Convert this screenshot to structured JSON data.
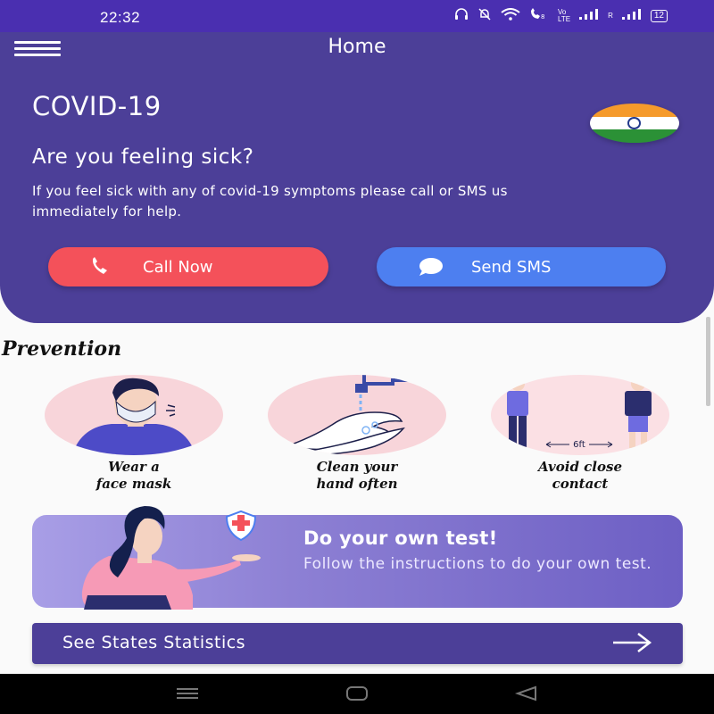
{
  "status_bar": {
    "time": "22:32",
    "indicators": [
      "headphones-icon",
      "mute-icon",
      "wifi-icon",
      "vowifi-icon",
      "volte-icon",
      "signal-icon",
      "signal-r-icon"
    ],
    "vo_label": "Vo\nLTE",
    "r_label": "R",
    "battery": "12"
  },
  "header": {
    "title": "Home",
    "menu_icon": "hamburger-icon"
  },
  "hero": {
    "title": "COVID-19",
    "question": "Are you feeling sick?",
    "description": "If you feel sick with any of covid-19 symptoms please call or SMS us immediately for help.",
    "call_label": "Call Now",
    "sms_label": "Send SMS",
    "flag": "india-flag-icon",
    "colors": {
      "background": "#4c3f98",
      "call": "#f4515a",
      "sms": "#4d7ff0"
    }
  },
  "prevention": {
    "title": "Prevention",
    "items": [
      {
        "label_line1": "Wear a",
        "label_line2": "face mask",
        "icon": "face-mask-illustration"
      },
      {
        "label_line1": "Clean your",
        "label_line2": "hand often",
        "icon": "hand-washing-illustration"
      },
      {
        "label_line1": "Avoid close",
        "label_line2": "contact",
        "icon": "social-distance-illustration"
      }
    ],
    "distance_label": "6ft"
  },
  "test_card": {
    "title": "Do your own test!",
    "description": "Follow the instructions to do your own test.",
    "icon": "medical-shield-icon"
  },
  "states_button": {
    "label": "See States Statistics",
    "icon": "arrow-right-icon"
  },
  "nav_bar": [
    "recents-icon",
    "home-icon",
    "back-icon"
  ]
}
